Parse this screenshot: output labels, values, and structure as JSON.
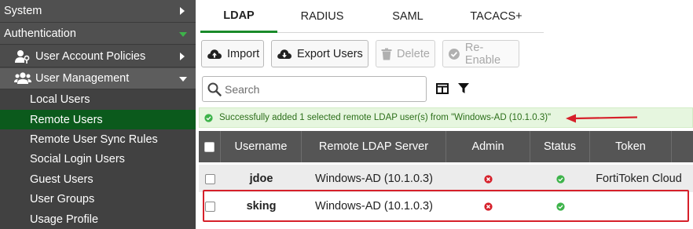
{
  "sidebar": {
    "top_items": [
      {
        "label": "System",
        "caret": "right"
      },
      {
        "label": "Authentication",
        "caret": "down"
      }
    ],
    "sub_items": [
      {
        "label": "User Account Policies",
        "icon": "user-key-icon",
        "caret": "right"
      },
      {
        "label": "User Management",
        "icon": "users-icon",
        "caret": "down"
      }
    ],
    "leaf_items": [
      {
        "label": "Local Users",
        "active": false
      },
      {
        "label": "Remote Users",
        "active": true
      },
      {
        "label": "Remote User Sync Rules",
        "active": false
      },
      {
        "label": "Social Login Users",
        "active": false
      },
      {
        "label": "Guest Users",
        "active": false
      },
      {
        "label": "User Groups",
        "active": false
      },
      {
        "label": "Usage Profile",
        "active": false
      }
    ],
    "colors": {
      "background": "#4a4a4a",
      "active": "#0b5a1c"
    }
  },
  "tabs": [
    {
      "label": "LDAP",
      "active": true
    },
    {
      "label": "RADIUS",
      "active": false
    },
    {
      "label": "SAML",
      "active": false
    },
    {
      "label": "TACACS+",
      "active": false
    }
  ],
  "toolbar": {
    "import_label": "Import",
    "export_label": "Export Users",
    "delete_label": "Delete",
    "reenable_label": "Re-Enable"
  },
  "search": {
    "placeholder": "Search",
    "value": ""
  },
  "message": {
    "text": "Successfully added 1 selected remote LDAP user(s) from \"Windows-AD (10.1.0.3)\"",
    "status": "success",
    "color": "#2c6f1a"
  },
  "table": {
    "columns": [
      "",
      "Username",
      "Remote LDAP Server",
      "Admin",
      "Status",
      "Token"
    ],
    "rows": [
      {
        "username": "jdoe",
        "server": "Windows-AD (10.1.0.3)",
        "admin": "no",
        "status": "enabled",
        "token": "FortiToken Cloud"
      },
      {
        "username": "sking",
        "server": "Windows-AD (10.1.0.3)",
        "admin": "no",
        "status": "enabled",
        "token": ""
      }
    ]
  },
  "colors": {
    "accent": "#1a8b2a",
    "error_icon": "#d6202a",
    "ok_icon": "#3db34a",
    "annotation": "#d6202a"
  }
}
